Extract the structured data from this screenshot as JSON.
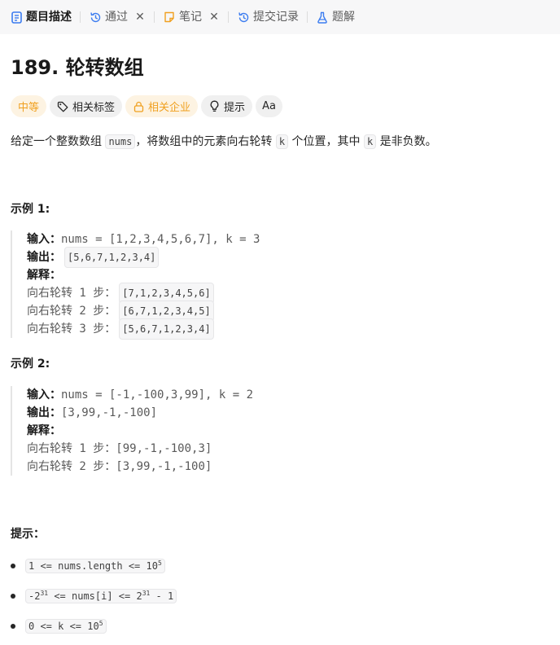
{
  "tabs": [
    {
      "label": "题目描述",
      "icon": "description-icon",
      "active": true,
      "closable": false
    },
    {
      "label": "通过",
      "icon": "history-icon",
      "active": false,
      "closable": true
    },
    {
      "label": "笔记",
      "icon": "note-icon",
      "active": false,
      "closable": true
    },
    {
      "label": "提交记录",
      "icon": "history-icon",
      "active": false,
      "closable": false
    },
    {
      "label": "题解",
      "icon": "flask-icon",
      "active": false,
      "closable": false
    }
  ],
  "problem": {
    "title": "189. 轮转数组",
    "tags": {
      "difficulty": "中等",
      "related_tags": "相关标签",
      "related_companies": "相关企业",
      "hint": "提示",
      "font_toggle": "Aa"
    },
    "description": {
      "part1": "给定一个整数数组 ",
      "code1": "nums",
      "part2": "，将数组中的元素向右轮转 ",
      "code2": "k",
      "part3": " 个位置，其中 ",
      "code3": "k",
      "part4": " 是非负数。"
    }
  },
  "examples": [
    {
      "heading": "示例 1:",
      "input_label": "输入：",
      "input_value": "nums = [1,2,3,4,5,6,7], k = 3",
      "output_label": "输出：",
      "output_value": "[5,6,7,1,2,3,4]",
      "explain_label": "解释：",
      "steps": [
        {
          "text": "向右轮转 1 步：",
          "value": "[7,1,2,3,4,5,6]"
        },
        {
          "text": "向右轮转 2 步：",
          "value": "[6,7,1,2,3,4,5]"
        },
        {
          "text": "向右轮转 3 步：",
          "value": "[5,6,7,1,2,3,4]"
        }
      ]
    },
    {
      "heading": "示例 2:",
      "input_label": "输入：",
      "input_value": "nums = [-1,-100,3,99], k = 2",
      "output_label": "输出：",
      "output_value": "[3,99,-1,-100]",
      "explain_label": "解释：",
      "steps": [
        {
          "text": "向右轮转 1 步：",
          "value": "[99,-1,-100,3]"
        },
        {
          "text": "向右轮转 2 步：",
          "value": "[3,99,-1,-100]"
        }
      ]
    }
  ],
  "constraints": {
    "heading": "提示：",
    "items": [
      {
        "pre": "1 <= nums.length <= 10",
        "sup": "5",
        "post": ""
      },
      {
        "pre": "-2",
        "sup": "31",
        "mid": " <= nums[i] <= 2",
        "sup2": "31",
        "post": " - 1"
      },
      {
        "pre": "0 <= k <= 10",
        "sup": "5",
        "post": ""
      }
    ]
  },
  "colors": {
    "accent_orange": "#f0a020",
    "tag_bg": "#f0f0f0",
    "tabbar_bg": "#f7f7f8",
    "active_tab_icon": "#3b7cf0"
  }
}
